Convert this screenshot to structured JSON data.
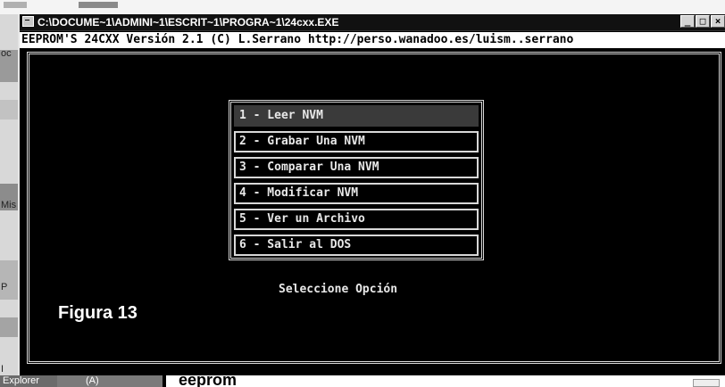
{
  "window": {
    "title": "C:\\DOCUME~1\\ADMINI~1\\ESCRIT~1\\PROGRA~1\\24cxx.EXE",
    "minimize": "_",
    "maximize": "□",
    "close": "×"
  },
  "console": {
    "header": "EEPROM'S 24CXX Versión 2.1 (C) L.Serrano  http://perso.wanadoo.es/luism..serrano",
    "menu": [
      {
        "label": "1 - Leer NVM",
        "selected": true
      },
      {
        "label": "2 - Grabar Una NVM",
        "selected": false
      },
      {
        "label": "3 - Comparar Una NVM",
        "selected": false
      },
      {
        "label": "4 - Modificar NVM",
        "selected": false
      },
      {
        "label": "5 - Ver un Archivo",
        "selected": false
      },
      {
        "label": "6 - Salir al DOS",
        "selected": false
      }
    ],
    "prompt": "Seleccione Opción"
  },
  "figure_label": "Figura 13",
  "desktop": {
    "edge_labels": [
      "oc",
      "Mis",
      "P",
      "I"
    ]
  },
  "taskbar": {
    "explorer": "Explorer",
    "item_a": "(A)",
    "active": "eeprom"
  },
  "colors": {
    "console_bg": "#000000",
    "console_fg": "#e8e8e8",
    "header_bg": "#ffffff",
    "selection_bg": "#3a3a3a"
  }
}
